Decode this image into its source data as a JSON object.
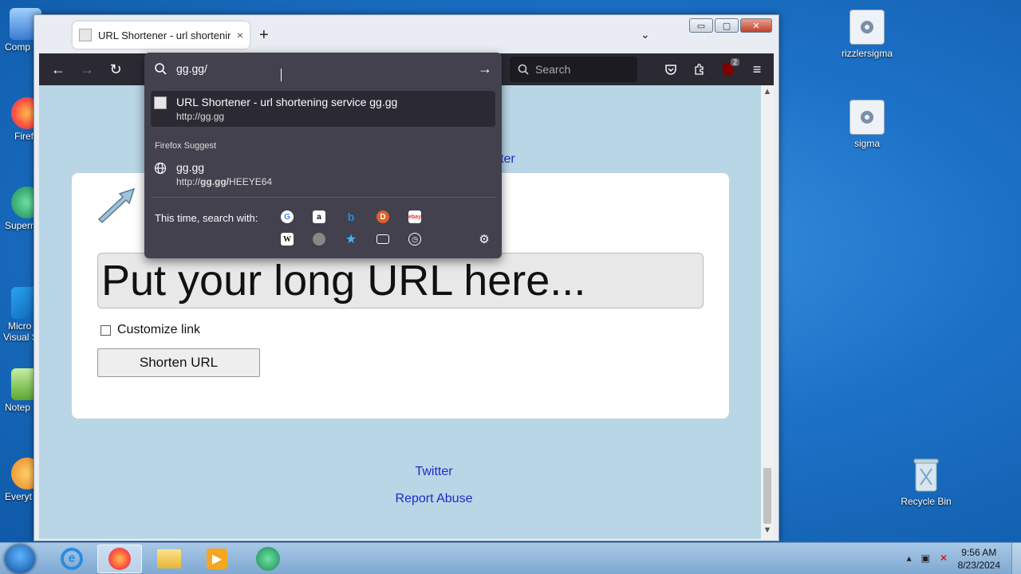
{
  "desktop": {
    "right_icons": [
      {
        "label": "rizzlersigma"
      },
      {
        "label": "sigma"
      },
      {
        "label": "Recycle Bin"
      }
    ],
    "left_icons": [
      {
        "label": "Comp"
      },
      {
        "label": "Firef"
      },
      {
        "label": "Superm"
      },
      {
        "label": "Micro"
      },
      {
        "label": "Visual S"
      },
      {
        "label": "Notep"
      },
      {
        "label": "Everyt"
      }
    ]
  },
  "browser": {
    "tab": {
      "title": "URL Shortener - url shortening",
      "close": "×"
    },
    "new_tab": "+",
    "tab_list": "⌄",
    "window_controls": {
      "minimize": "▭",
      "maximize": "▢",
      "close": "✕"
    },
    "nav": {
      "back": "←",
      "forward": "→",
      "reload": "↻"
    },
    "search": {
      "placeholder": "Search"
    },
    "toolbar": {
      "badge": "2",
      "menu": "≡"
    },
    "urlbar": {
      "value": "gg.gg/",
      "go": "→",
      "results": [
        {
          "title": "URL Shortener - url shortening service gg.gg",
          "url": "http://gg.gg"
        }
      ],
      "suggest_header": "Firefox Suggest",
      "suggestion": {
        "title": "gg.gg",
        "url_prefix": "http://",
        "url_host": "gg.gg/",
        "url_path": "HEEYE64"
      },
      "oneoff_label": "This time, search with:"
    }
  },
  "page": {
    "partial_link": "ter",
    "url_placeholder": "Put your long URL here...",
    "customize_label": "Customize link",
    "shorten_button": "Shorten URL",
    "footer": {
      "twitter": "Twitter",
      "report": "Report Abuse"
    }
  },
  "taskbar": {
    "time": "9:56 AM",
    "date": "8/23/2024"
  }
}
